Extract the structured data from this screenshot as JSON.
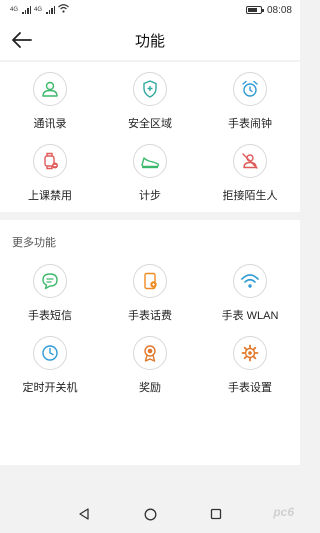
{
  "status_bar": {
    "signal_label_1": "4G",
    "signal_label_2": "4G",
    "time": "08:08"
  },
  "header": {
    "title": "功能"
  },
  "main_features": [
    {
      "label": "通讯录",
      "icon": "contacts-icon",
      "color": "#3cb86b"
    },
    {
      "label": "安全区域",
      "icon": "safe-zone-icon",
      "color": "#2fa9a0"
    },
    {
      "label": "手表闹钟",
      "icon": "alarm-clock-icon",
      "color": "#2e9bd6"
    },
    {
      "label": "上课禁用",
      "icon": "class-disable-icon",
      "color": "#e05a5a"
    },
    {
      "label": "计步",
      "icon": "step-counter-icon",
      "color": "#3cb86b"
    },
    {
      "label": "拒接陌生人",
      "icon": "reject-stranger-icon",
      "color": "#e05a5a"
    }
  ],
  "more_section": {
    "title": "更多功能"
  },
  "more_features": [
    {
      "label": "手表短信",
      "icon": "sms-icon",
      "color": "#3cb86b"
    },
    {
      "label": "手表话费",
      "icon": "phone-bill-icon",
      "color": "#f08a24"
    },
    {
      "label": "手表 WLAN",
      "icon": "wifi-icon",
      "color": "#2e9bd6"
    },
    {
      "label": "定时开关机",
      "icon": "timer-power-icon",
      "color": "#2e9bd6"
    },
    {
      "label": "奖励",
      "icon": "reward-medal-icon",
      "color": "#e0772a"
    },
    {
      "label": "手表设置",
      "icon": "settings-gear-icon",
      "color": "#e0772a"
    }
  ],
  "watermark": {
    "text": "pc6"
  }
}
